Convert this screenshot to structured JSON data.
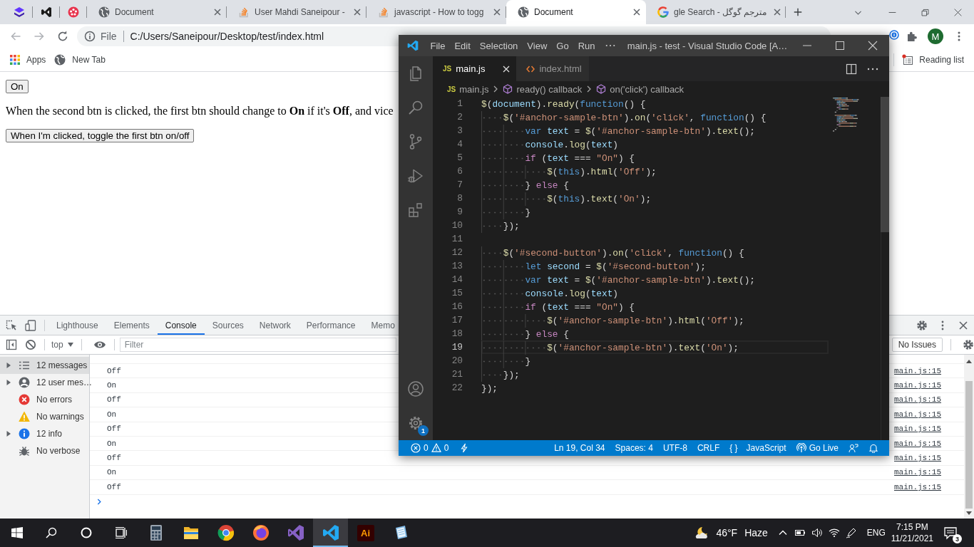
{
  "browser": {
    "tabs": [
      {
        "kind": "layers",
        "pinned": true,
        "selected": false
      },
      {
        "kind": "vs",
        "pinned": true,
        "selected": false
      },
      {
        "kind": "berry",
        "pinned": true,
        "selected": false
      },
      {
        "kind": "globe",
        "pinned": false,
        "label": "Document",
        "selected": false
      },
      {
        "kind": "stackoverflow",
        "pinned": false,
        "label": "User Mahdi Saneipour -",
        "selected": false
      },
      {
        "kind": "stackoverflow",
        "pinned": false,
        "label": "javascript - How to togg",
        "selected": false
      },
      {
        "kind": "globe",
        "pinned": false,
        "label": "Document",
        "selected": true
      },
      {
        "kind": "google",
        "pinned": false,
        "label": "مترجم گوگل - gle Search",
        "selected": false
      }
    ],
    "address_bar": {
      "scheme": "File",
      "url": "C:/Users/Saneipour/Desktop/test/index.html"
    },
    "profile_initial": "M",
    "bookmarks": [
      {
        "kind": "apps",
        "label": "Apps"
      },
      {
        "kind": "globe",
        "label": "New Tab"
      }
    ],
    "reading_list": "Reading list"
  },
  "page": {
    "toggle_button": "On",
    "paragraph": "When the second btn is clicked, the first btn should change to **On** if it's **Off**, and vice",
    "second_button": "When I'm clicked, toggle the first btn on/off"
  },
  "devtools": {
    "tabs": [
      {
        "label": "Lighthouse",
        "selected": false
      },
      {
        "label": "Elements",
        "selected": false
      },
      {
        "label": "Console",
        "selected": true
      },
      {
        "label": "Sources",
        "selected": false
      },
      {
        "label": "Network",
        "selected": false
      },
      {
        "label": "Performance",
        "selected": false
      },
      {
        "label": "Memo",
        "selected": false
      }
    ],
    "context": "top",
    "filter_placeholder": "Filter",
    "issues_button": "No Issues",
    "sidebar": [
      {
        "kind": "list",
        "label": "12 messages",
        "expandable": true,
        "selected": true
      },
      {
        "kind": "user",
        "label": "12 user mes…",
        "expandable": true,
        "selected": false
      },
      {
        "kind": "error",
        "label": "No errors",
        "expandable": false,
        "selected": false
      },
      {
        "kind": "warning",
        "label": "No warnings",
        "expandable": false,
        "selected": false
      },
      {
        "kind": "info",
        "label": "12 info",
        "expandable": true,
        "selected": false
      },
      {
        "kind": "verbose",
        "label": "No verbose",
        "expandable": false,
        "selected": false
      }
    ],
    "messages": [
      {
        "text": "Off",
        "source": "main.js:15"
      },
      {
        "text": "On",
        "source": "main.js:15"
      },
      {
        "text": "Off",
        "source": "main.js:15"
      },
      {
        "text": "On",
        "source": "main.js:15"
      },
      {
        "text": "Off",
        "source": "main.js:15"
      },
      {
        "text": "On",
        "source": "main.js:15"
      },
      {
        "text": "Off",
        "source": "main.js:15"
      },
      {
        "text": "On",
        "source": "main.js:15"
      },
      {
        "text": "Off",
        "source": "main.js:15"
      }
    ]
  },
  "editor": {
    "title": "main.js - test - Visual Studio Code [A…",
    "menu": [
      "File",
      "Edit",
      "Selection",
      "View",
      "Go",
      "Run"
    ],
    "tabs": [
      {
        "kind": "js",
        "icon_text": "JS",
        "label": "main.js",
        "selected": true
      },
      {
        "kind": "html",
        "label": "index.html",
        "selected": false
      }
    ],
    "breadcrumbs": [
      {
        "kind": "file",
        "icon_text": "JS",
        "label": "main.js"
      },
      {
        "kind": "symbol",
        "label": "ready() callback"
      },
      {
        "kind": "symbol",
        "label": "on('click') callback"
      }
    ],
    "lines": [
      {
        "number": "1",
        "current": false,
        "tokens": [
          {
            "kind": "fn",
            "text": "$"
          },
          {
            "kind": "p",
            "text": "("
          },
          {
            "kind": "var",
            "text": "document"
          },
          {
            "kind": "p",
            "text": ")."
          },
          {
            "kind": "fn",
            "text": "ready"
          },
          {
            "kind": "p",
            "text": "("
          },
          {
            "kind": "kw",
            "text": "function"
          },
          {
            "kind": "p",
            "text": "() {"
          }
        ]
      },
      {
        "number": "2",
        "current": false,
        "tokens": [
          {
            "kind": "fn",
            "text": "    $"
          },
          {
            "kind": "p",
            "text": "("
          },
          {
            "kind": "str",
            "text": "'#anchor-sample-btn'"
          },
          {
            "kind": "p",
            "text": ")."
          },
          {
            "kind": "fn",
            "text": "on"
          },
          {
            "kind": "p",
            "text": "("
          },
          {
            "kind": "str",
            "text": "'click'"
          },
          {
            "kind": "p",
            "text": ", "
          },
          {
            "kind": "kw",
            "text": "function"
          },
          {
            "kind": "p",
            "text": "() {"
          }
        ]
      },
      {
        "number": "3",
        "current": false,
        "tokens": [
          {
            "kind": "kw",
            "text": "        var "
          },
          {
            "kind": "var",
            "text": "text"
          },
          {
            "kind": "p",
            "text": " = "
          },
          {
            "kind": "fn",
            "text": "$"
          },
          {
            "kind": "p",
            "text": "("
          },
          {
            "kind": "str",
            "text": "'#anchor-sample-btn'"
          },
          {
            "kind": "p",
            "text": ")."
          },
          {
            "kind": "fn",
            "text": "text"
          },
          {
            "kind": "p",
            "text": "();"
          }
        ]
      },
      {
        "number": "4",
        "current": false,
        "tokens": [
          {
            "kind": "var",
            "text": "        console"
          },
          {
            "kind": "p",
            "text": "."
          },
          {
            "kind": "fn",
            "text": "log"
          },
          {
            "kind": "p",
            "text": "("
          },
          {
            "kind": "var",
            "text": "text"
          },
          {
            "kind": "p",
            "text": ")"
          }
        ]
      },
      {
        "number": "5",
        "current": false,
        "tokens": [
          {
            "kind": "ctl",
            "text": "        if"
          },
          {
            "kind": "p",
            "text": " ("
          },
          {
            "kind": "var",
            "text": "text"
          },
          {
            "kind": "p",
            "text": " === "
          },
          {
            "kind": "str",
            "text": "\"On\""
          },
          {
            "kind": "p",
            "text": ") {"
          }
        ]
      },
      {
        "number": "6",
        "current": false,
        "tokens": [
          {
            "kind": "fn",
            "text": "            $"
          },
          {
            "kind": "p",
            "text": "("
          },
          {
            "kind": "kw",
            "text": "this"
          },
          {
            "kind": "p",
            "text": ")."
          },
          {
            "kind": "fn",
            "text": "html"
          },
          {
            "kind": "p",
            "text": "("
          },
          {
            "kind": "str",
            "text": "'Off'"
          },
          {
            "kind": "p",
            "text": ");"
          }
        ]
      },
      {
        "number": "7",
        "current": false,
        "tokens": [
          {
            "kind": "p",
            "text": "        } "
          },
          {
            "kind": "ctl",
            "text": "else"
          },
          {
            "kind": "p",
            "text": " {"
          }
        ]
      },
      {
        "number": "8",
        "current": false,
        "tokens": [
          {
            "kind": "fn",
            "text": "            $"
          },
          {
            "kind": "p",
            "text": "("
          },
          {
            "kind": "kw",
            "text": "this"
          },
          {
            "kind": "p",
            "text": ")."
          },
          {
            "kind": "fn",
            "text": "text"
          },
          {
            "kind": "p",
            "text": "("
          },
          {
            "kind": "str",
            "text": "'On'"
          },
          {
            "kind": "p",
            "text": ");"
          }
        ]
      },
      {
        "number": "9",
        "current": false,
        "tokens": [
          {
            "kind": "p",
            "text": "        }"
          }
        ]
      },
      {
        "number": "10",
        "current": false,
        "tokens": [
          {
            "kind": "p",
            "text": "    });"
          }
        ]
      },
      {
        "number": "11",
        "current": false
      },
      {
        "number": "12",
        "current": false,
        "tokens": [
          {
            "kind": "fn",
            "text": "    $"
          },
          {
            "kind": "p",
            "text": "("
          },
          {
            "kind": "str",
            "text": "'#second-button'"
          },
          {
            "kind": "p",
            "text": ")."
          },
          {
            "kind": "fn",
            "text": "on"
          },
          {
            "kind": "p",
            "text": "("
          },
          {
            "kind": "str",
            "text": "'click'"
          },
          {
            "kind": "p",
            "text": ", "
          },
          {
            "kind": "kw",
            "text": "function"
          },
          {
            "kind": "p",
            "text": "() {"
          }
        ]
      },
      {
        "number": "13",
        "current": false,
        "tokens": [
          {
            "kind": "kw",
            "text": "        let "
          },
          {
            "kind": "var",
            "text": "second"
          },
          {
            "kind": "p",
            "text": " = "
          },
          {
            "kind": "fn",
            "text": "$"
          },
          {
            "kind": "p",
            "text": "("
          },
          {
            "kind": "str",
            "text": "'#second-button'"
          },
          {
            "kind": "p",
            "text": ");"
          }
        ]
      },
      {
        "number": "14",
        "current": false,
        "tokens": [
          {
            "kind": "kw",
            "text": "        var "
          },
          {
            "kind": "var",
            "text": "text"
          },
          {
            "kind": "p",
            "text": " = "
          },
          {
            "kind": "fn",
            "text": "$"
          },
          {
            "kind": "p",
            "text": "("
          },
          {
            "kind": "str",
            "text": "'#anchor-sample-btn'"
          },
          {
            "kind": "p",
            "text": ")."
          },
          {
            "kind": "fn",
            "text": "text"
          },
          {
            "kind": "p",
            "text": "();"
          }
        ]
      },
      {
        "number": "15",
        "current": false,
        "tokens": [
          {
            "kind": "var",
            "text": "        console"
          },
          {
            "kind": "p",
            "text": "."
          },
          {
            "kind": "fn",
            "text": "log"
          },
          {
            "kind": "p",
            "text": "("
          },
          {
            "kind": "var",
            "text": "text"
          },
          {
            "kind": "p",
            "text": ")"
          }
        ]
      },
      {
        "number": "16",
        "current": false,
        "tokens": [
          {
            "kind": "ctl",
            "text": "        if"
          },
          {
            "kind": "p",
            "text": " ("
          },
          {
            "kind": "var",
            "text": "text"
          },
          {
            "kind": "p",
            "text": " === "
          },
          {
            "kind": "str",
            "text": "\"On\""
          },
          {
            "kind": "p",
            "text": ") {"
          }
        ]
      },
      {
        "number": "17",
        "current": false,
        "tokens": [
          {
            "kind": "fn",
            "text": "            $"
          },
          {
            "kind": "p",
            "text": "("
          },
          {
            "kind": "str",
            "text": "'#anchor-sample-btn'"
          },
          {
            "kind": "p",
            "text": ")."
          },
          {
            "kind": "fn",
            "text": "html"
          },
          {
            "kind": "p",
            "text": "("
          },
          {
            "kind": "str",
            "text": "'Off'"
          },
          {
            "kind": "p",
            "text": ");"
          }
        ]
      },
      {
        "number": "18",
        "current": false,
        "tokens": [
          {
            "kind": "p",
            "text": "        } "
          },
          {
            "kind": "ctl",
            "text": "else"
          },
          {
            "kind": "p",
            "text": " {"
          }
        ]
      },
      {
        "number": "19",
        "current": true,
        "tokens": [
          {
            "kind": "fn",
            "text": "            $"
          },
          {
            "kind": "p",
            "text": "("
          },
          {
            "kind": "str",
            "text": "'#anchor-sample-btn'"
          },
          {
            "kind": "p",
            "text": ")."
          },
          {
            "kind": "fn",
            "text": "text"
          },
          {
            "kind": "p",
            "text": "("
          },
          {
            "kind": "str",
            "text": "'On'"
          },
          {
            "kind": "p",
            "text": ");"
          }
        ]
      },
      {
        "number": "20",
        "current": false,
        "tokens": [
          {
            "kind": "p",
            "text": "        }"
          }
        ]
      },
      {
        "number": "21",
        "current": false,
        "tokens": [
          {
            "kind": "p",
            "text": "    });"
          }
        ]
      },
      {
        "number": "22",
        "current": false,
        "tokens": [
          {
            "kind": "p",
            "text": "});"
          }
        ]
      }
    ],
    "settings_badge": "1",
    "status": {
      "errors": "0",
      "warnings": "0",
      "position": "Ln 19, Col 34",
      "indentation": "Spaces: 4",
      "encoding": "UTF-8",
      "line_ending": "CRLF",
      "language_glyph": "{ }",
      "language": "JavaScript",
      "live_server": "Go Live"
    }
  },
  "taskbar": {
    "apps": [
      {
        "kind": "calculator",
        "active": false
      },
      {
        "kind": "explorer",
        "active": false
      },
      {
        "kind": "chrome",
        "active": false
      },
      {
        "kind": "firefox",
        "active": false
      },
      {
        "kind": "studio",
        "active": false
      },
      {
        "kind": "vscode",
        "active": true
      },
      {
        "kind": "illustrator",
        "label": "Ai",
        "active": false
      },
      {
        "kind": "notes",
        "active": false
      }
    ],
    "temperature": "46°F",
    "condition": "Haze",
    "language": "ENG",
    "time": "7:15 PM",
    "date": "11/21/2021",
    "notification_count": "3"
  }
}
